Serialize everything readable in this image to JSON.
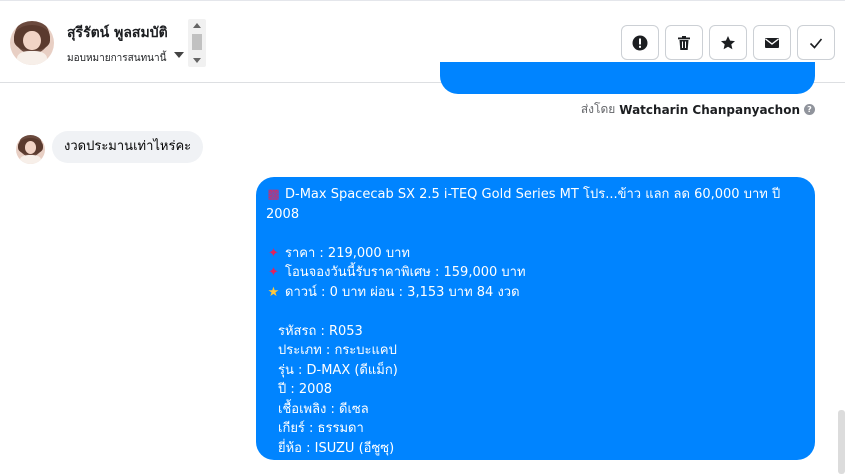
{
  "header": {
    "contact_name": "สุรีรัตน์ พูลสมบัติ",
    "assign_label": "มอบหมายการสนทนานี้"
  },
  "actions": [
    {
      "name": "report-icon"
    },
    {
      "name": "trash-icon"
    },
    {
      "name": "star-icon"
    },
    {
      "name": "envelope-icon"
    },
    {
      "name": "check-icon"
    }
  ],
  "sent_by": {
    "prefix": "ส่งโดย",
    "name": "Watcharin Chanpanyachon"
  },
  "incoming_message": "งวดประมานเท่าไหร่คะ",
  "outgoing_message": {
    "title_line1": "D-Max Spacecab SX 2.5 i-TEQ Gold Series MT โปร...ข้าว แลก ลด 60,000 บาท ปี",
    "title_line2": "2008",
    "price": "ราคา : 219,000 บาท",
    "promo": "โอนจองวันนี้รับราคาพิเศษ : 159,000 บาท",
    "down": "ดาวน์ : 0 บาท ผ่อน : 3,153 บาท 84 งวด",
    "code": "รหัสรถ : R053",
    "type": "ประเภท : กระบะแคป",
    "model": "รุ่น : D-MAX (ดีแม็ก)",
    "year": "ปี : 2008",
    "fuel": "เชื้อเพลิง : ดีเซล",
    "gear": "เกียร์ : ธรรมดา",
    "brand": "ยี่ห้อ : ISUZU (อีซูซุ)"
  },
  "colors": {
    "accent": "#0084ff",
    "incoming_bg": "#f0f2f5"
  }
}
